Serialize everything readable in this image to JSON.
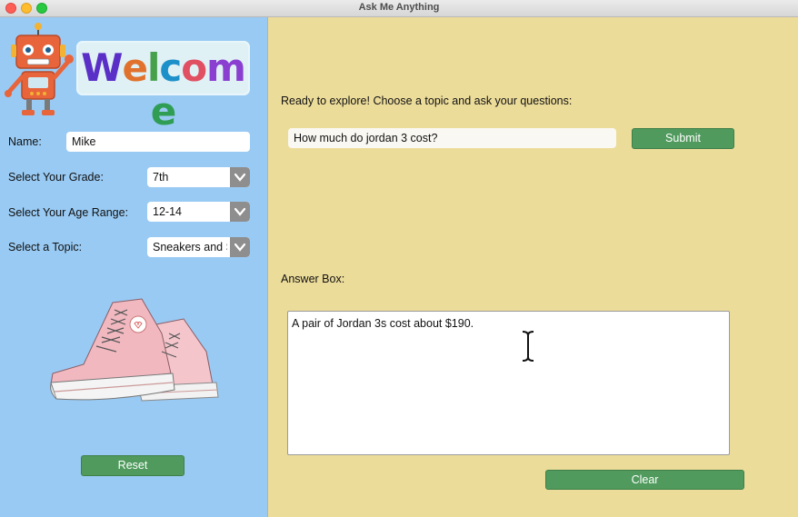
{
  "window": {
    "title": "Ask Me Anything"
  },
  "sidebar": {
    "welcome": [
      "W",
      "e",
      "l",
      "c",
      "o",
      "m",
      "e"
    ],
    "welcome_colors": [
      "#5a2fc7",
      "#e0722d",
      "#47a04a",
      "#1d90c9",
      "#e04f62",
      "#8a3fd1",
      "#2f9d54"
    ],
    "name_label": "Name:",
    "name_value": "Mike",
    "grade_label": "Select Your Grade:",
    "grade_value": "7th",
    "age_label": "Select Your Age Range:",
    "age_value": "12-14",
    "topic_label": "Select a Topic:",
    "topic_value": "Sneakers and Shoes",
    "reset_label": "Reset"
  },
  "main": {
    "prompt": "Ready to explore! Choose a topic and ask your questions:",
    "question_value": "How much do jordan 3 cost?",
    "submit_label": "Submit",
    "answer_label": "Answer Box:",
    "answer_text": "A pair of Jordan 3s cost about $190.",
    "clear_label": "Clear"
  },
  "colors": {
    "sidebar_bg": "#99caf3",
    "main_bg": "#ecdc9a",
    "button_green": "#4f9a5c"
  }
}
